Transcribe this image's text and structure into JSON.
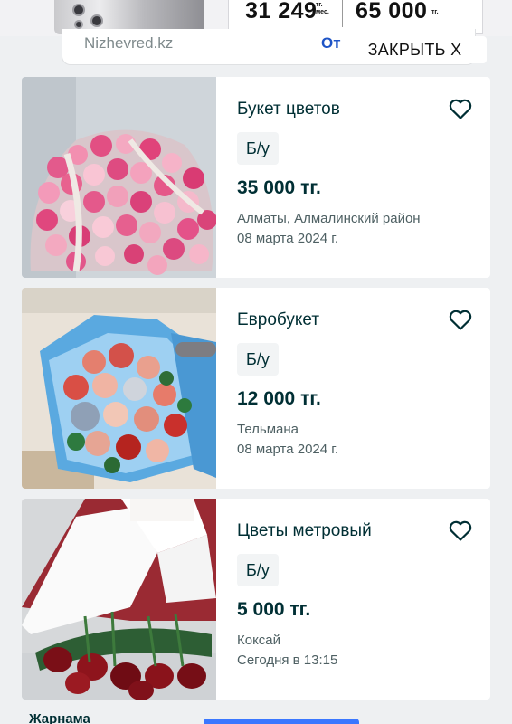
{
  "ad": {
    "price_monthly": "31 249",
    "price_monthly_unit_line1": "тг.",
    "price_monthly_unit_line2": "мес.",
    "price_full": "65 000",
    "price_full_unit": "тг.",
    "source": "Nizhevred.kz",
    "open_label": "От",
    "close_label": "ЗАКРЫТЬ X"
  },
  "listings": [
    {
      "title": "Букет цветов",
      "condition": "Б/у",
      "price": "35 000 тг.",
      "location": "Алматы, Алмалинский район",
      "date": "08 марта 2024 г.",
      "favorite_icon": "heart-outline-icon"
    },
    {
      "title": "Евробукет",
      "condition": "Б/у",
      "price": "12 000 тг.",
      "location": "Тельмана",
      "date": "08 марта 2024 г.",
      "favorite_icon": "heart-outline-icon"
    },
    {
      "title": "Цветы метровый",
      "condition": "Б/у",
      "price": "5 000 тг.",
      "location": "Коксай",
      "date": "Сегодня в 13:15",
      "favorite_icon": "heart-outline-icon"
    }
  ],
  "footer": {
    "ad_label": "Жарнама"
  },
  "colors": {
    "primary_text": "#002f34",
    "accent_blue": "#3a77ff",
    "background": "#eef0f2"
  }
}
